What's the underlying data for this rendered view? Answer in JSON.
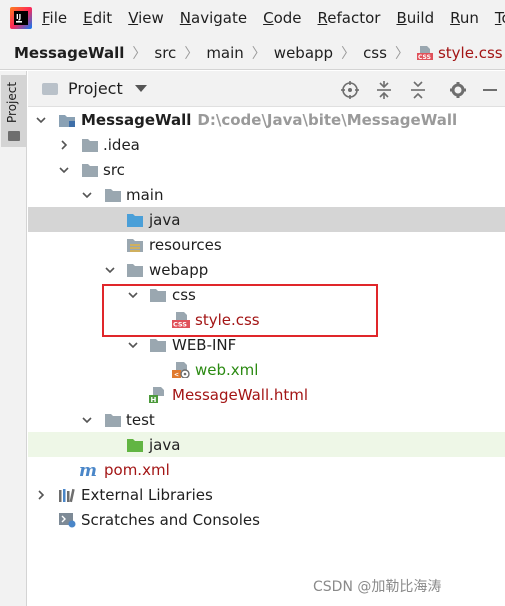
{
  "menubar": {
    "items": [
      "File",
      "Edit",
      "View",
      "Navigate",
      "Code",
      "Refactor",
      "Build",
      "Run",
      "To"
    ]
  },
  "breadcrumb": {
    "items": [
      "MessageWall",
      "src",
      "main",
      "webapp",
      "css",
      "style.css"
    ]
  },
  "stripe": {
    "label": "Project"
  },
  "tool_window": {
    "title": "Project",
    "icons": [
      "locate-icon",
      "collapse-all-icon",
      "settings-icon",
      "minimize-icon"
    ]
  },
  "tree": {
    "root": {
      "label": "MessageWall",
      "path": "D:\\code\\Java\\bite\\MessageWall"
    },
    "idea": ".idea",
    "src": "src",
    "main": "main",
    "java_main": "java",
    "resources": "resources",
    "webapp": "webapp",
    "css": "css",
    "style_css": "style.css",
    "web_inf": "WEB-INF",
    "web_xml": "web.xml",
    "message_wall_html": "MessageWall.html",
    "test": "test",
    "java_test": "java",
    "pom": "pom.xml",
    "external_libraries": "External Libraries",
    "scratches": "Scratches and Consoles"
  },
  "colors": {
    "selection": "#d5d5d5",
    "test_highlight": "#eef7e7",
    "annotation_box": "#e0262a",
    "css_file_text": "#a31515",
    "xml_file_text": "#2b8a12"
  },
  "watermark": "CSDN @加勒比海涛"
}
